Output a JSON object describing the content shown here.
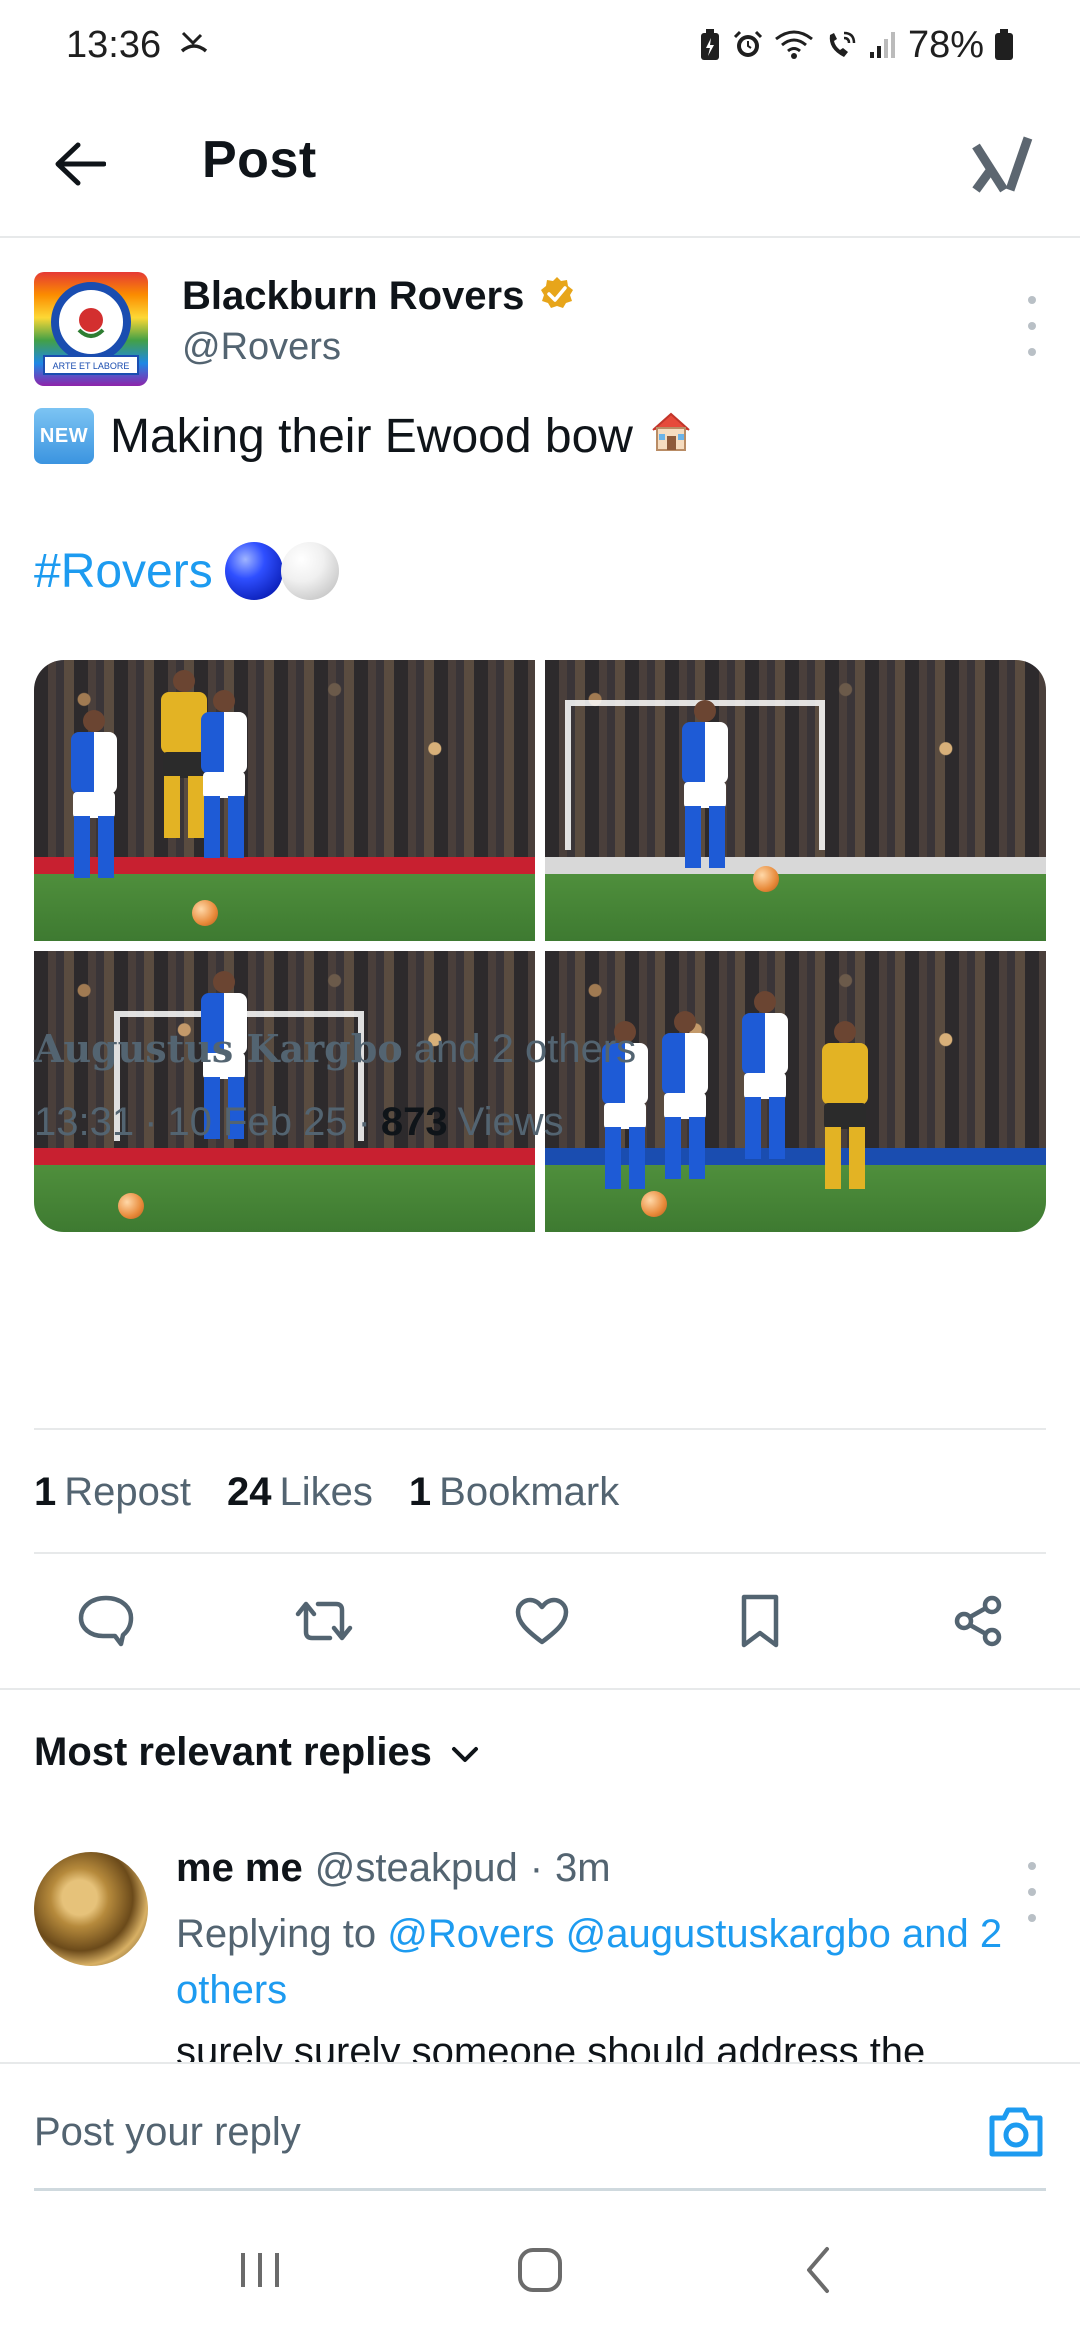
{
  "status_bar": {
    "time": "13:36",
    "battery": "78%",
    "icons": [
      "missed-call-icon",
      "battery-saver-icon",
      "alarm-icon",
      "wifi-icon",
      "wifi-calling-icon",
      "signal-icon",
      "battery-icon"
    ]
  },
  "header": {
    "title": "Post",
    "back_icon": "back-arrow-icon",
    "right_icon": "grok-icon"
  },
  "post": {
    "author": {
      "name": "Blackburn Rovers",
      "handle": "@Rovers",
      "verified": true,
      "verified_color": "#f4b400"
    },
    "avatar_text": {
      "top": "BLACKBURN ROVERS",
      "banner": "ARTE ET LABORE"
    },
    "badge": "NEW",
    "text": "Making their Ewood bow",
    "hashtag": "#Rovers",
    "photo_count": 4,
    "liked_by": {
      "name": "Augustus Kargbo",
      "others": "and 2 others"
    },
    "meta": {
      "time": "13:31",
      "separator": "·",
      "date": "10 Feb 25",
      "views_count": "873",
      "views_label": "Views"
    },
    "stats": {
      "reposts_count": "1",
      "reposts_label": "Repost",
      "likes_count": "24",
      "likes_label": "Likes",
      "bookmarks_count": "1",
      "bookmarks_label": "Bookmark"
    },
    "actions": [
      "reply-icon",
      "repost-icon",
      "like-icon",
      "bookmark-icon",
      "share-icon"
    ]
  },
  "replies": {
    "sort_label": "Most relevant replies",
    "items": [
      {
        "name": "me me",
        "handle": "@steakpud",
        "separator": "·",
        "time": "3m",
        "replying_to_label": "Replying to",
        "mentions": "@Rovers @augustuskargbo and 2 others",
        "text": "surely surely someone should address the"
      }
    ]
  },
  "composer": {
    "placeholder": "Post your reply"
  },
  "colors": {
    "accent": "#1d9bf0",
    "secondary_text": "#536471",
    "primary_text": "#0f1419"
  }
}
